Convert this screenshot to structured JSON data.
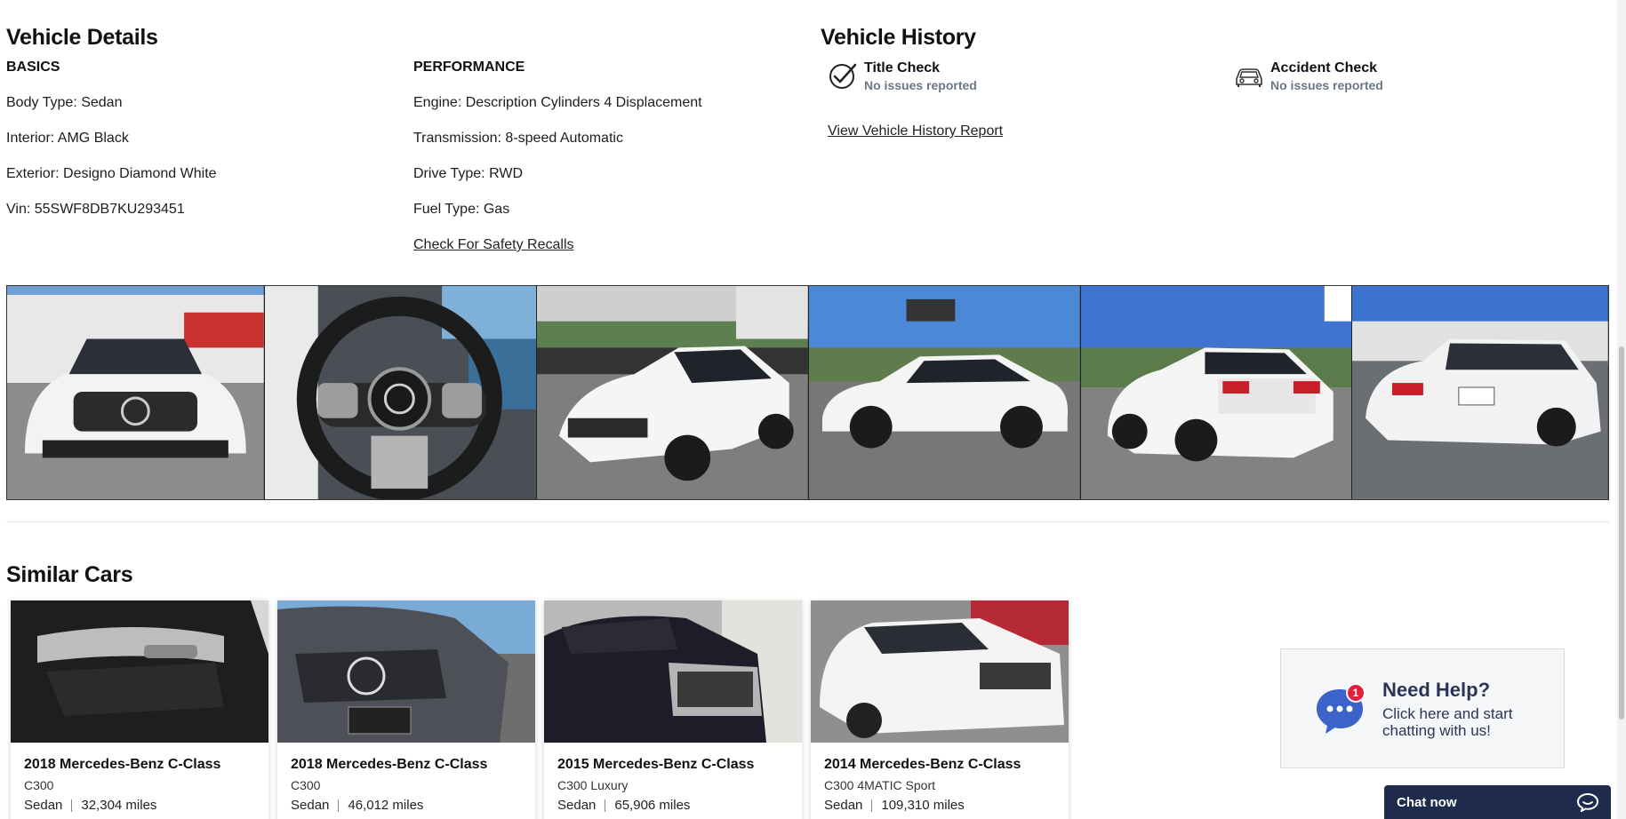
{
  "details": {
    "title": "Vehicle Details",
    "basics_label": "BASICS",
    "basics": [
      "Body Type: Sedan",
      "Interior: AMG Black",
      "Exterior: Designo Diamond White",
      "Vin: 55SWF8DB7KU293451"
    ],
    "performance_label": "PERFORMANCE",
    "performance": [
      "Engine: Description Cylinders 4 Displacement",
      "Transmission: 8-speed Automatic",
      "Drive Type: RWD",
      "Fuel Type: Gas"
    ],
    "recalls_link": "Check For Safety Recalls"
  },
  "history": {
    "title": "Vehicle History",
    "title_check": {
      "label": "Title Check",
      "status": "No issues reported",
      "icon": "checkmark-circle-icon"
    },
    "accident_check": {
      "label": "Accident Check",
      "status": "No issues reported",
      "icon": "car-icon"
    },
    "report_link": "View Vehicle History Report"
  },
  "gallery": {
    "photos": [
      "front-view",
      "steering-wheel",
      "front-three-quarter",
      "side-profile",
      "rear-three-quarter",
      "rear-view"
    ]
  },
  "similar": {
    "title": "Similar Cars",
    "cars": [
      {
        "title": "2018 Mercedes-Benz C-Class",
        "trim": "C300",
        "body": "Sedan",
        "miles": "32,304 miles"
      },
      {
        "title": "2018 Mercedes-Benz C-Class",
        "trim": "C300",
        "body": "Sedan",
        "miles": "46,012 miles"
      },
      {
        "title": "2015 Mercedes-Benz C-Class",
        "trim": "C300 Luxury",
        "body": "Sedan",
        "miles": "65,906 miles"
      },
      {
        "title": "2014 Mercedes-Benz C-Class",
        "trim": "C300 4MATIC Sport",
        "body": "Sedan",
        "miles": "109,310 miles"
      }
    ]
  },
  "help": {
    "title": "Need Help?",
    "subtitle": "Click here and start chatting with us!",
    "badge": "1",
    "icon": "chat-bubble-icon"
  },
  "chat": {
    "label": "Chat now",
    "icon": "chat-icon"
  },
  "colors": {
    "chat_bar": "#1f2b4d",
    "help_text": "#2b3556",
    "help_icon": "#3b63c9",
    "badge": "#e0213d",
    "status_gray": "#6b7785"
  }
}
